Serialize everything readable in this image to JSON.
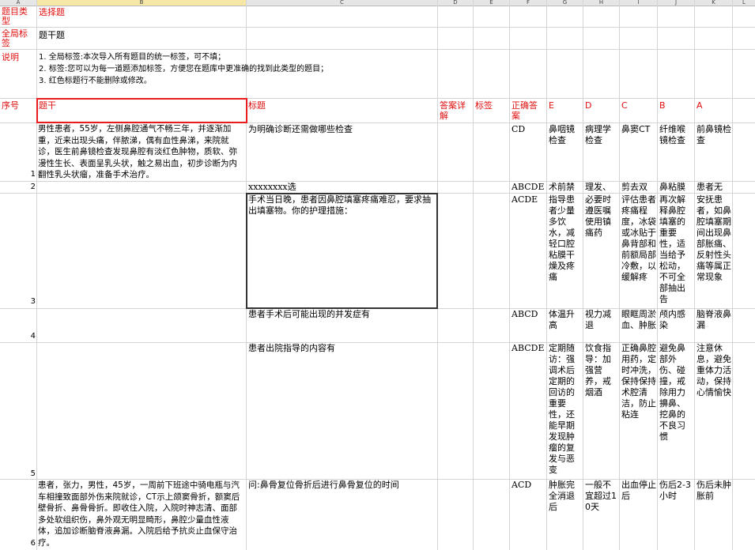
{
  "columns": [
    "A",
    "B",
    "C",
    "D",
    "E",
    "F",
    "G",
    "H",
    "I",
    "J",
    "K",
    "L"
  ],
  "meta_rows": {
    "type_label": "题目类型",
    "type_value": "选择题",
    "tag_label": "全局标签",
    "tag_value": "题干题",
    "note_label": "说明",
    "note_lines": [
      "1. 全局标签:本次导入所有题目的统一标签，可不填；",
      "2. 标签:您可以为每一道题添加标签，方便您在题库中更准确的找到此类型的题目；",
      "3. 红色标题行不能删除或修改。"
    ]
  },
  "header": {
    "seq": "序号",
    "stem": "题干",
    "title": "标题",
    "answer_detail": "答案详解",
    "tag": "标签",
    "correct": "正确答案",
    "E": "E",
    "D": "D",
    "C": "C",
    "B": "B",
    "A": "A"
  },
  "rows": [
    {
      "num": "1",
      "stem": "男性患者，55岁，左侧鼻腔通气不畅三年，并逐渐加重，近来出现头痛，伴脓涕，偶有血性鼻涕，来院就诊，医生前鼻镜检查发现鼻腔有淡红色肿物，质软、弥漫性生长、表面呈乳头状，触之易出血，初步诊断为内翻性乳头状瘤，准备手术治疗。",
      "title": "为明确诊断还需做哪些检查",
      "correct": "CD",
      "E": "鼻咽镜检查",
      "D": "病理学检查",
      "C": "鼻窦CT",
      "B": "纤维喉镜检查",
      "A": "前鼻镜检查"
    },
    {
      "num": "2",
      "stem": "",
      "title": "xxxxxxxx选",
      "correct": "ABCDE",
      "E": "术前禁",
      "D": "理发、",
      "C": "剪去双",
      "B": "鼻粘膜",
      "A": "患者无"
    },
    {
      "num": "3",
      "stem": "",
      "title": "手术当日晚，患者因鼻腔填塞疼痛难忍，要求抽出填塞物。你的护理措施：",
      "correct": "ACDE",
      "E": "指导患者少量多饮水，减轻口腔粘膜干燥及疼痛",
      "D": "必要时遵医嘱使用镇痛药",
      "C": "评估患者疼痛程度，冰袋或冰贴于鼻背部和前额局部冷敷，以缓解疼",
      "B": "再次解释鼻腔填塞的重要性，适当给予松动，不可全部抽出告",
      "A": "安抚患者，如鼻腔填塞期间出现鼻部胀痛、反射性头痛等属正常现象"
    },
    {
      "num": "4",
      "stem": "",
      "title": "患者手术后可能出现的并发症有",
      "correct": "ABCD",
      "E": "体温升高",
      "D": "视力减退",
      "C": "眼眶周淤血、肿胀",
      "B": "颅内感染",
      "A": "脑脊液鼻漏"
    },
    {
      "num": "5",
      "stem": "",
      "title": "患者出院指导的内容有",
      "correct": "ABCDE",
      "E": "定期随访：强调术后定期的回访的重要性，还能早期发现肿瘤的复发与恶变",
      "D": "饮食指导：加强营养，戒烟酒",
      "C": "正确鼻腔用药，定时冲洗，保持保持术腔清洁，防止粘连",
      "B": "避免鼻部外伤、碰撞，戒除用力擤鼻、挖鼻的不良习惯",
      "A": "注意休息，避免重体力活动，保持心情愉快"
    },
    {
      "num": "6",
      "stem": "患者，张力，男性，45岁，一周前下班途中骑电瓶与汽车相撞致面部外伤来院就诊，CT示上颌窦骨折，额窦后壁骨折、鼻骨骨折。即收住入院，入院时神志清、面部多处软组织伤，鼻外观无明显畸形，鼻腔少量血性液体，追加诊断脑脊液鼻漏。入院后给予抗炎止血保守治疗。",
      "title": "问:鼻骨复位骨折后进行鼻骨复位的时间",
      "correct": "ACD",
      "E": "肿胀完全消退后",
      "D": "一般不宜超过10天",
      "C": "出血停止后",
      "B": "伤后2-3小时",
      "A": "伤后未肿胀前"
    }
  ]
}
